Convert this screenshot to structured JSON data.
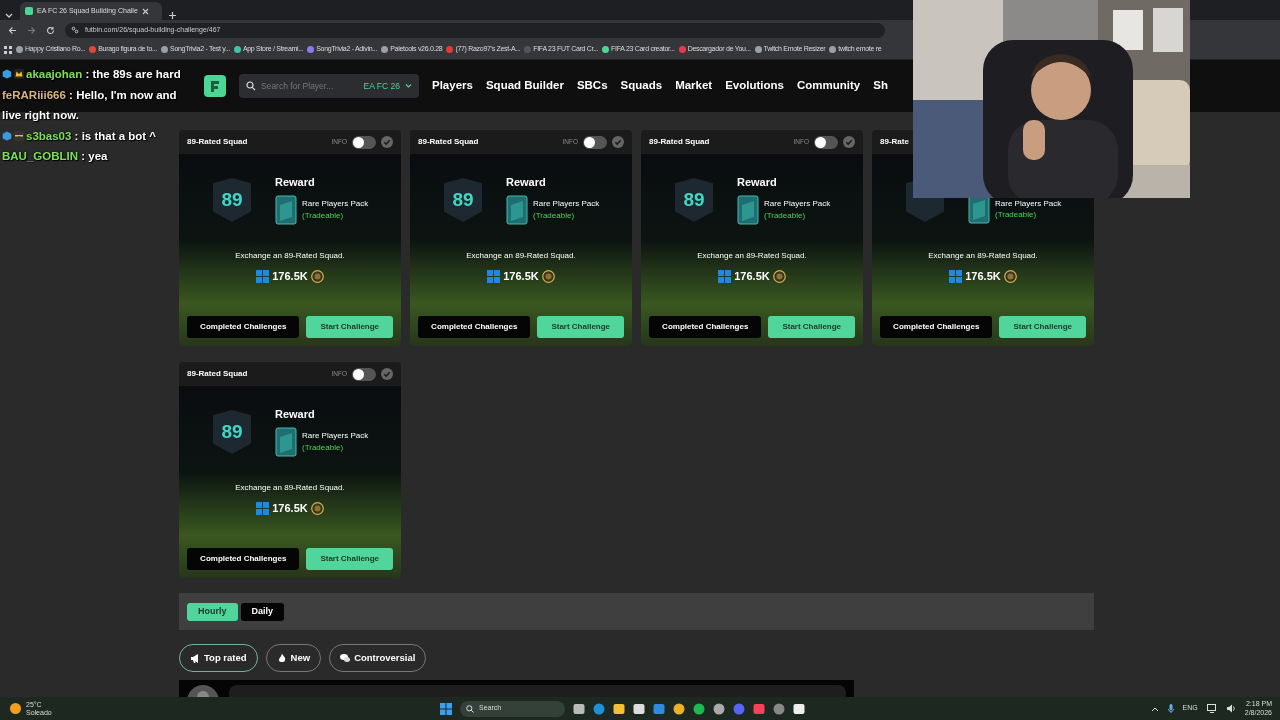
{
  "browser": {
    "tab_title": "EA FC 26 Squad Building Challe",
    "url": "futbin.com/26/squad-building-challenge/467",
    "bookmarks": [
      {
        "label": "Happy Cristiano Ro...",
        "color": "#9aa0a6"
      },
      {
        "label": "Burago figura de to...",
        "color": "#e0473b"
      },
      {
        "label": "SongTrivia2 - Test y...",
        "color": "#9aa0a6"
      },
      {
        "label": "App Store / Streami...",
        "color": "#3fc4a8"
      },
      {
        "label": "SongTrivia2 - Adivin...",
        "color": "#8a7cf0"
      },
      {
        "label": "Paletools v26.0.28",
        "color": "#9aa0a6"
      },
      {
        "label": "(77) Razo97's Zest-A...",
        "color": "#e53935"
      },
      {
        "label": "FIFA 23 FUT Card Cr...",
        "color": "#555555"
      },
      {
        "label": "FIFA 23 Card creator...",
        "color": "#4cd696"
      },
      {
        "label": "Descargador de You...",
        "color": "#e53950"
      },
      {
        "label": "Twitch Emote Resizer",
        "color": "#9aa0a6"
      },
      {
        "label": "twitch emote re",
        "color": "#9aa0a6"
      }
    ]
  },
  "chat": [
    {
      "badges": [
        {
          "kind": "cube"
        },
        {
          "kind": "crown"
        }
      ],
      "user": "akaajohan",
      "color": "#7ee05a",
      "text": ": the 89s are hard"
    },
    {
      "user": "feRARiii666",
      "color": "#d9b77a",
      "text": ": Hello, I'm now and live right now."
    },
    {
      "badges": [
        {
          "kind": "cube"
        },
        {
          "kind": "glasses"
        }
      ],
      "user": "s3bas03",
      "color": "#7ee05a",
      "text": ": is that a bot ^"
    },
    {
      "user": "BAU_GOBLIN",
      "color": "#7ee05a",
      "text": ": yea"
    }
  ],
  "site_nav": {
    "search": {
      "placeholder": "Search for Player...",
      "version": "EA FC 26"
    },
    "links": [
      "Players",
      "Squad Builder",
      "SBCs",
      "Squads",
      "Market",
      "Evolutions",
      "Community",
      "Sh"
    ]
  },
  "sbc_cards": [
    {
      "title": "89-Rated Squad",
      "info": "INFO",
      "toggle_on": false,
      "rating": "89",
      "reward_label": "Reward",
      "pack": "Rare Players Pack",
      "pack_note": "(Tradeable)",
      "description": "Exchange an 89-Rated Squad.",
      "price": "176.5K",
      "buttons": [
        "Completed Challenges",
        "Start Challenge"
      ]
    },
    {
      "title": "89-Rated Squad",
      "info": "INFO",
      "toggle_on": false,
      "rating": "89",
      "reward_label": "Reward",
      "pack": "Rare Players Pack",
      "pack_note": "(Tradeable)",
      "description": "Exchange an 89-Rated Squad.",
      "price": "176.5K",
      "buttons": [
        "Completed Challenges",
        "Start Challenge"
      ]
    },
    {
      "title": "89-Rated Squad",
      "info": "INFO",
      "toggle_on": false,
      "rating": "89",
      "reward_label": "Reward",
      "pack": "Rare Players Pack",
      "pack_note": "(Tradeable)",
      "description": "Exchange an 89-Rated Squad.",
      "price": "176.5K",
      "buttons": [
        "Completed Challenges",
        "Start Challenge"
      ]
    },
    {
      "title": "89-Rate",
      "pack": "Rare Players Pack",
      "pack_note": "(Tradeable)",
      "description": "Exchange an 89-Rated Squad.",
      "price": "176.5K",
      "buttons": [
        "Completed Challenges",
        "Start Challenge"
      ]
    },
    {
      "title": "89-Rated Squad",
      "info": "INFO",
      "toggle_on": false,
      "rating": "89",
      "reward_label": "Reward",
      "pack": "Rare Players Pack",
      "pack_note": "(Tradeable)",
      "description": "Exchange an 89-Rated Squad.",
      "price": "176.5K",
      "buttons": [
        "Completed Challenges",
        "Start Challenge"
      ]
    }
  ],
  "period_tabs": [
    {
      "label": "Hourly",
      "selected": true
    },
    {
      "label": "Daily",
      "selected": false
    }
  ],
  "sort_filters": [
    {
      "label": "Top rated",
      "selected": true,
      "kind": "megaphone"
    },
    {
      "label": "New",
      "selected": false,
      "kind": "flame"
    },
    {
      "label": "Controversial",
      "selected": false,
      "kind": "chat"
    }
  ],
  "taskbar": {
    "temperature": "25°C",
    "condition": "Soleado",
    "search": "Search",
    "language": "ENG",
    "time": "2:18 PM",
    "date": "2/8/2026"
  }
}
